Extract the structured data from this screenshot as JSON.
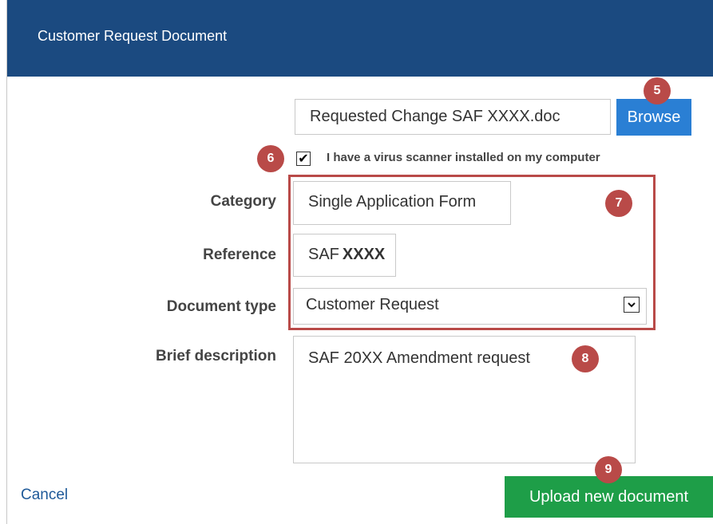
{
  "dialog": {
    "title": "Customer Request Document"
  },
  "file": {
    "filename": "Requested Change SAF XXXX.doc",
    "browse_label": "Browse"
  },
  "virus_check": {
    "checked": true,
    "check_glyph": "✔",
    "label": "I have a virus scanner installed on my computer"
  },
  "form": {
    "category_label": "Category",
    "category_value": "Single Application Form",
    "reference_label": "Reference",
    "reference_prefix": "SAF",
    "reference_suffix": "XXXX",
    "document_type_label": "Document type",
    "document_type_value": "Customer Request",
    "document_type_arrow": "❯",
    "description_label": "Brief description",
    "description_value": "SAF 20XX Amendment request"
  },
  "actions": {
    "cancel_label": "Cancel",
    "upload_label": "Upload new document"
  },
  "callouts": {
    "browse": "5",
    "virus": "6",
    "fields": "7",
    "description": "8",
    "upload": "9"
  },
  "colors": {
    "title_bar": "#1b4a80",
    "browse_button": "#2a7fd4",
    "upload_button": "#1e9e48",
    "callout": "#b94a48",
    "link": "#1f5a99"
  },
  "icons": {
    "checkbox": "checkmark-icon",
    "select": "chevron-down-icon"
  }
}
